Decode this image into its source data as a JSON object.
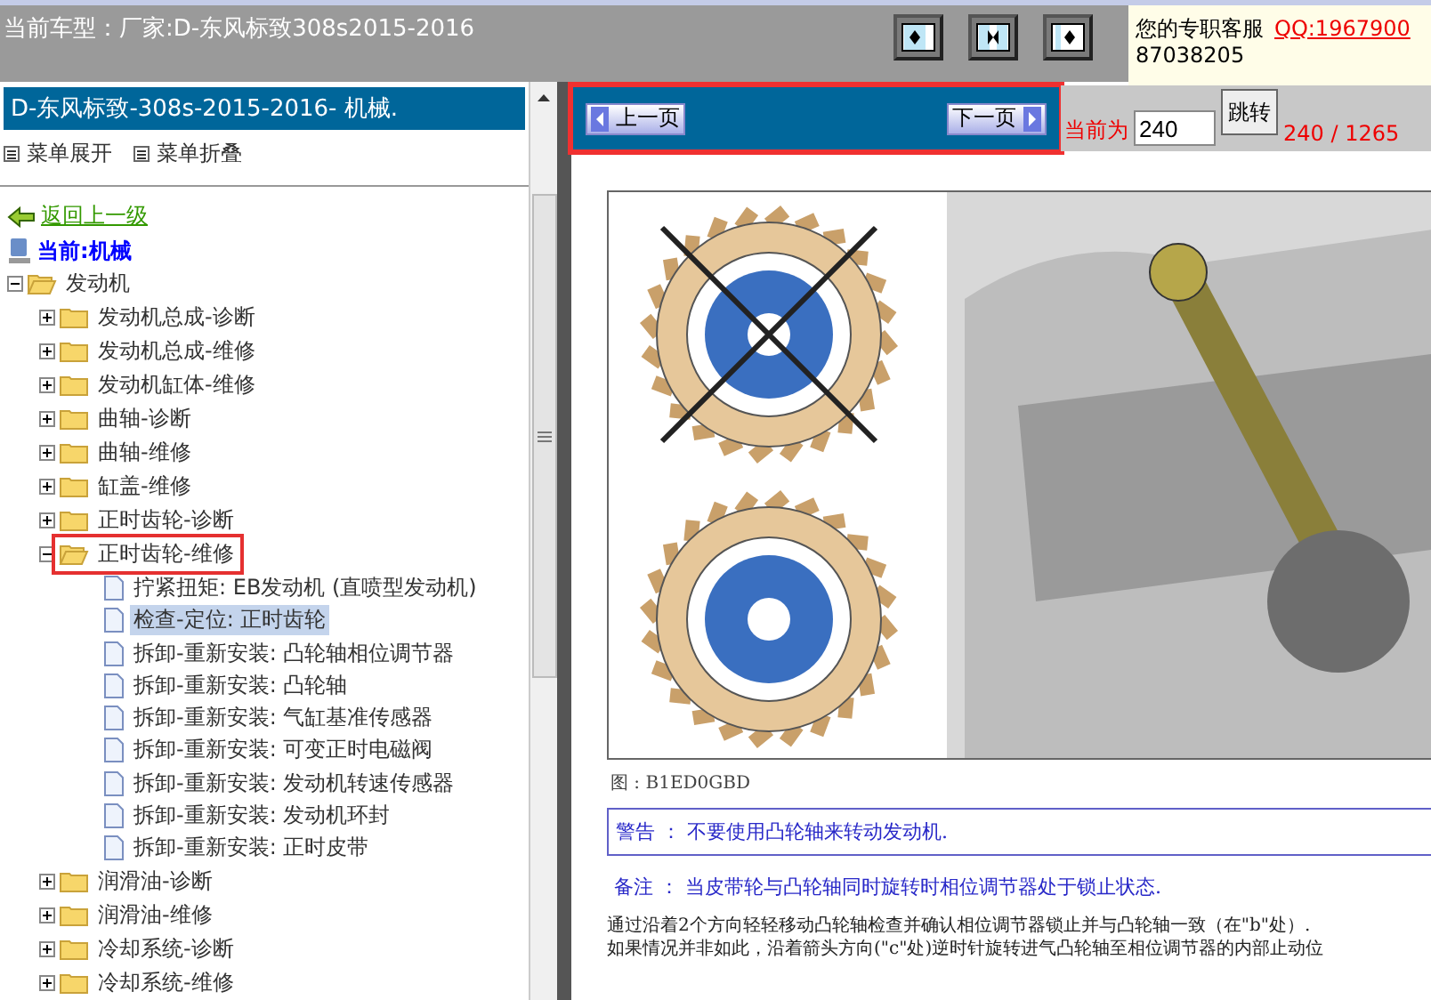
{
  "top_bar": {
    "title": "当前车型：厂家:D-东风标致308s2015-2016",
    "service_label": "您的专职客服",
    "service_link": "QQ:1967900",
    "service_phone": "87038205"
  },
  "layout_buttons": [
    {
      "kind": "left"
    },
    {
      "kind": "both"
    },
    {
      "kind": "right"
    }
  ],
  "sidebar": {
    "title": "D-东风标致-308s-2015-2016- 机械.",
    "expand_all": "菜单展开",
    "collapse_all": "菜单折叠",
    "back_link": "返回上一级",
    "current": "当前:机械",
    "tree": [
      {
        "label": "发动机",
        "expanded": true,
        "highlighted": false,
        "children": [
          {
            "label": "发动机总成-诊断",
            "expanded": false,
            "highlighted": false
          },
          {
            "label": "发动机总成-维修",
            "expanded": false,
            "highlighted": false
          },
          {
            "label": "发动机缸体-维修",
            "expanded": false,
            "highlighted": false
          },
          {
            "label": "曲轴-诊断",
            "expanded": false,
            "highlighted": false
          },
          {
            "label": "曲轴-维修",
            "expanded": false,
            "highlighted": false
          },
          {
            "label": "缸盖-维修",
            "expanded": false,
            "highlighted": false
          },
          {
            "label": "正时齿轮-诊断",
            "expanded": false,
            "highlighted": false
          },
          {
            "label": "正时齿轮-维修",
            "expanded": true,
            "highlighted": true,
            "children": [
              {
                "label": "拧紧扭矩: EB发动机 (直喷型发动机)",
                "selected": false
              },
              {
                "label": "检查-定位: 正时齿轮",
                "selected": true
              },
              {
                "label": "拆卸-重新安装: 凸轮轴相位调节器",
                "selected": false
              },
              {
                "label": "拆卸-重新安装: 凸轮轴",
                "selected": false
              },
              {
                "label": "拆卸-重新安装: 气缸基准传感器",
                "selected": false
              },
              {
                "label": "拆卸-重新安装: 可变正时电磁阀",
                "selected": false
              },
              {
                "label": "拆卸-重新安装: 发动机转速传感器",
                "selected": false
              },
              {
                "label": "拆卸-重新安装: 发动机环封",
                "selected": false
              },
              {
                "label": "拆卸-重新安装: 正时皮带",
                "selected": false
              }
            ]
          },
          {
            "label": "润滑油-诊断",
            "expanded": false,
            "highlighted": false
          },
          {
            "label": "润滑油-维修",
            "expanded": false,
            "highlighted": false
          },
          {
            "label": "冷却系统-诊断",
            "expanded": false,
            "highlighted": false
          },
          {
            "label": "冷却系统-维修",
            "expanded": false,
            "highlighted": false
          }
        ]
      }
    ]
  },
  "pager": {
    "highlighted": true,
    "prev": "上一页",
    "next": "下一页",
    "current_label": "当前为",
    "page_value": "240",
    "jump": "跳转",
    "count": "240 / 1265"
  },
  "document": {
    "figure": {
      "kind": "picture"
    },
    "caption": "图 : B1ED0GBD",
    "warning": "警告 ： 不要使用凸轮轴来转动发动机.",
    "note": "备注 ： 当皮带轮与凸轮轴同时旋转时相位调节器处于锁止状态.",
    "body": [
      "通过沿着2个方向轻轻移动凸轮轴检查并确认相位调节器锁止并与凸轮轴一致（在\"b\"处）.",
      "如果情况并非如此，沿着箭头方向(\"c\"处)逆时针旋转进气凸轮轴至相位调节器的内部止动位"
    ]
  }
}
